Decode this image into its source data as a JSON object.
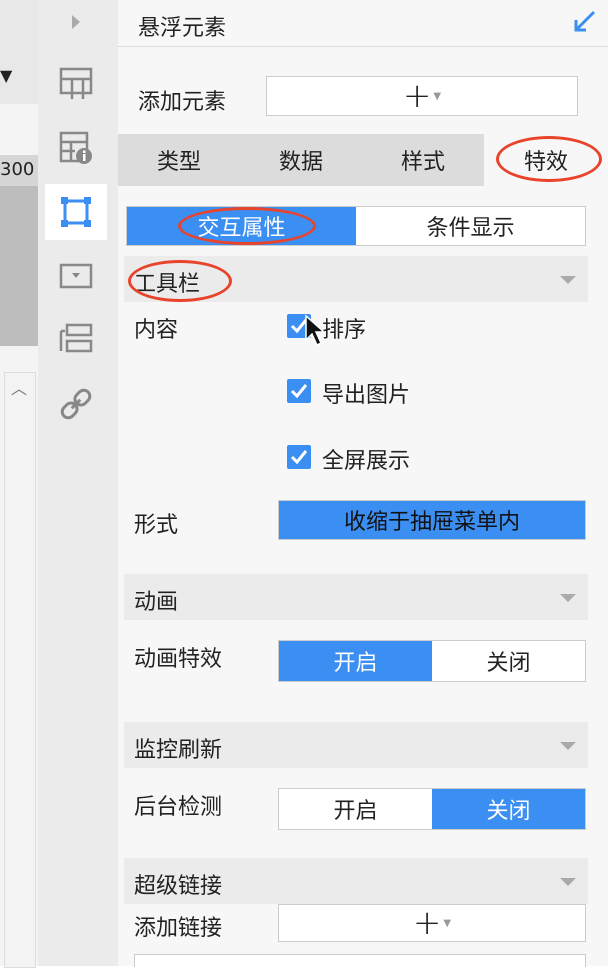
{
  "left_strip": {
    "ruler_label": "300"
  },
  "panel": {
    "title": "悬浮元素",
    "add_element_label": "添加元素",
    "add_symbol": "+",
    "tabs": [
      "类型",
      "数据",
      "样式",
      "特效"
    ],
    "subtabs": [
      "交互属性",
      "条件显示"
    ],
    "toolbar": {
      "section_title": "工具栏",
      "content_label": "内容",
      "checks": [
        "排序",
        "导出图片",
        "全屏展示"
      ],
      "form_label": "形式",
      "form_value": "收缩于抽屉菜单内"
    },
    "animation": {
      "section_title": "动画",
      "label": "动画特效",
      "options": [
        "开启",
        "关闭"
      ],
      "selected": "开启"
    },
    "refresh": {
      "section_title": "监控刷新",
      "label": "后台检测",
      "options": [
        "开启",
        "关闭"
      ],
      "selected": "关闭"
    },
    "hyperlink": {
      "section_title": "超级链接",
      "label": "添加链接",
      "add_symbol": "+"
    }
  },
  "colors": {
    "accent": "#3b8ff3",
    "highlight_oval": "#e8442c"
  }
}
